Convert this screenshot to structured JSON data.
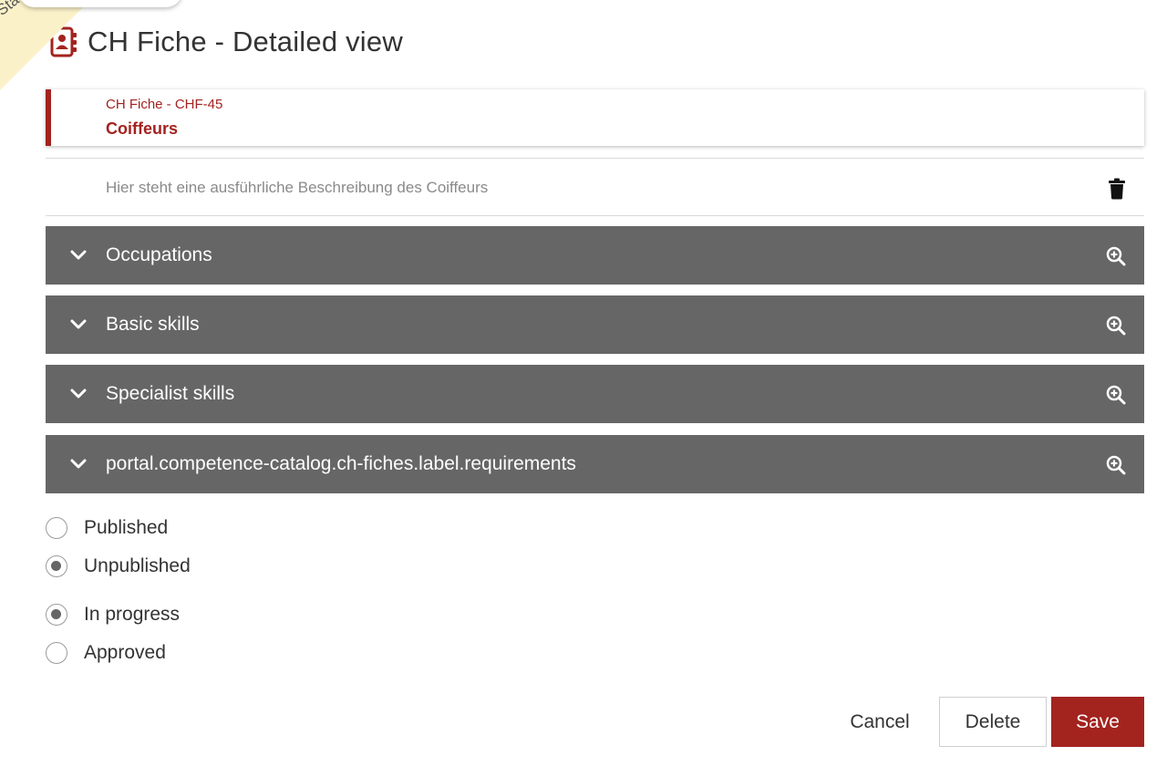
{
  "ribbon": {
    "text": "Sta"
  },
  "header": {
    "title": "CH Fiche - Detailed view",
    "icon": "contact-book-icon",
    "accent_color": "#a3231f"
  },
  "fiche": {
    "code": "CH Fiche - CHF-45",
    "name": "Coiffeurs",
    "description": "Hier steht eine ausführliche Beschreibung des Coiffeurs"
  },
  "sections": [
    {
      "label": "Occupations"
    },
    {
      "label": "Basic skills"
    },
    {
      "label": "Specialist skills"
    },
    {
      "label": "portal.competence-catalog.ch-fiches.label.requirements"
    }
  ],
  "publication_status": {
    "options": [
      {
        "label": "Published",
        "checked": false
      },
      {
        "label": "Unpublished",
        "checked": true
      }
    ]
  },
  "review_status": {
    "options": [
      {
        "label": "In progress",
        "checked": true
      },
      {
        "label": "Approved",
        "checked": false
      }
    ]
  },
  "actions": {
    "cancel_label": "Cancel",
    "delete_label": "Delete",
    "save_label": "Save"
  },
  "colors": {
    "section_bg": "#666666",
    "save_bg": "#a3231f"
  }
}
